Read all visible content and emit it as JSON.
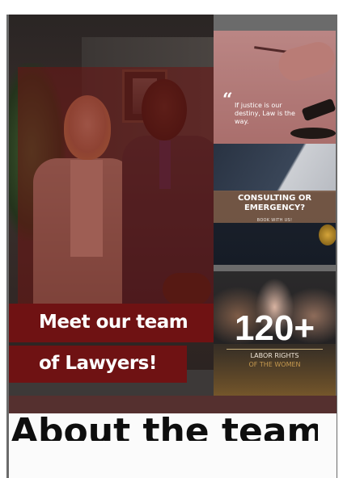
{
  "hero": {
    "headline_line1": "Meet our team",
    "headline_line2": "of Lawyers!"
  },
  "quote_card": {
    "mark": "“",
    "text": "If justice is our destiny, Law is the way."
  },
  "cta_card": {
    "title": "CONSULTING OR EMERGENCY?",
    "subtitle": "BOOK WITH US!"
  },
  "stat_card": {
    "number": "120+",
    "label_line1": "LABOR RIGHTS",
    "label_line2": "OF THE WOMEN"
  },
  "bottom": {
    "cut_text": "About the team"
  },
  "colors": {
    "brand_red": "#6f1213",
    "overlay_red": "#6e1412",
    "gold": "#c79a4f",
    "band_brown": "#55302f"
  },
  "icons": {
    "quote": "quote-icon",
    "gavel": "gavel-icon",
    "scale": "scale-icon"
  }
}
